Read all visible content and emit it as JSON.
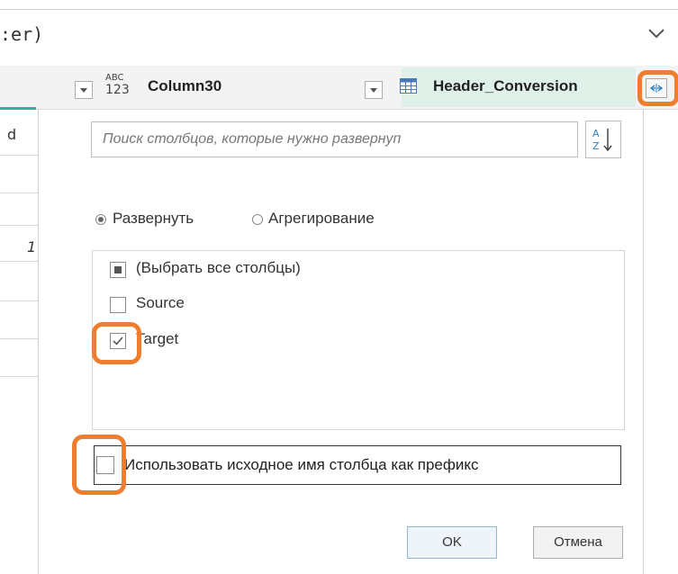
{
  "formula": {
    "text": ":er)"
  },
  "columns": {
    "col30": {
      "type_top": "ABC",
      "type_bottom": "123",
      "label": "Column30"
    },
    "header_conversion": {
      "label": "Header_Conversion"
    }
  },
  "left_grid": {
    "header_fragment": "d",
    "value_fragment": "1"
  },
  "panel": {
    "search_placeholder": "Поиск столбцов, которые нужно развернуп",
    "mode": {
      "expand_label": "Развернуть",
      "aggregate_label": "Агрегирование",
      "selected": "expand"
    },
    "items": [
      {
        "label": "(Выбрать все столбцы)",
        "state": "partial"
      },
      {
        "label": "Source",
        "state": "unchecked"
      },
      {
        "label": "Target",
        "state": "checked"
      }
    ],
    "prefix_label": "Использовать исходное имя столбца как префикс",
    "prefix_checked": false,
    "ok_label": "OK",
    "cancel_label": "Отмена"
  },
  "colors": {
    "highlight": "#ef7d2f",
    "accent_teal": "#2bb3a5",
    "header_conversion_bg": "#dff0e9"
  },
  "icons": {
    "formula_expand": "chevron-down-icon",
    "column_type": "abc-123-type-icon",
    "table_type": "table-icon",
    "expand_column": "expand-arrows-icon",
    "sort": "sort-az-icon"
  }
}
